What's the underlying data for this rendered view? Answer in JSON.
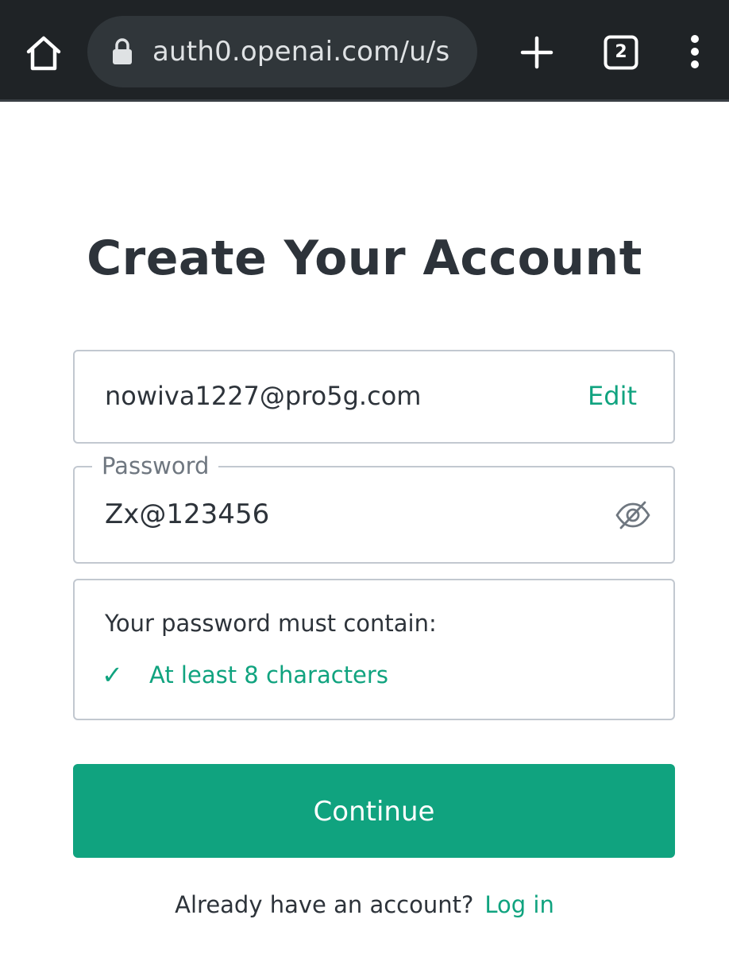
{
  "browser": {
    "url": "auth0.openai.com/u/s",
    "tab_count": "2",
    "icons": {
      "home": "home-icon",
      "lock": "lock-icon",
      "new_tab": "plus-icon",
      "tabs": "tab-switcher-icon",
      "menu": "more-vert-icon"
    }
  },
  "page": {
    "title": "Create Your Account",
    "email": {
      "value": "nowiva1227@pro5g.com",
      "edit_label": "Edit"
    },
    "password": {
      "label": "Password",
      "value": "Zx@123456",
      "toggle_icon": "eye-off-icon"
    },
    "requirements": {
      "heading": "Your password must contain:",
      "items": [
        {
          "check": "✓",
          "text": "At least 8 characters",
          "met": true
        }
      ]
    },
    "continue_label": "Continue",
    "footer": {
      "text": "Already have an account?",
      "login_label": "Log in"
    }
  },
  "colors": {
    "accent": "#10a37f",
    "text": "#2d333a",
    "border": "#c2c8d0",
    "chrome_bg": "#1f2326",
    "urlbar_bg": "#30363a"
  }
}
